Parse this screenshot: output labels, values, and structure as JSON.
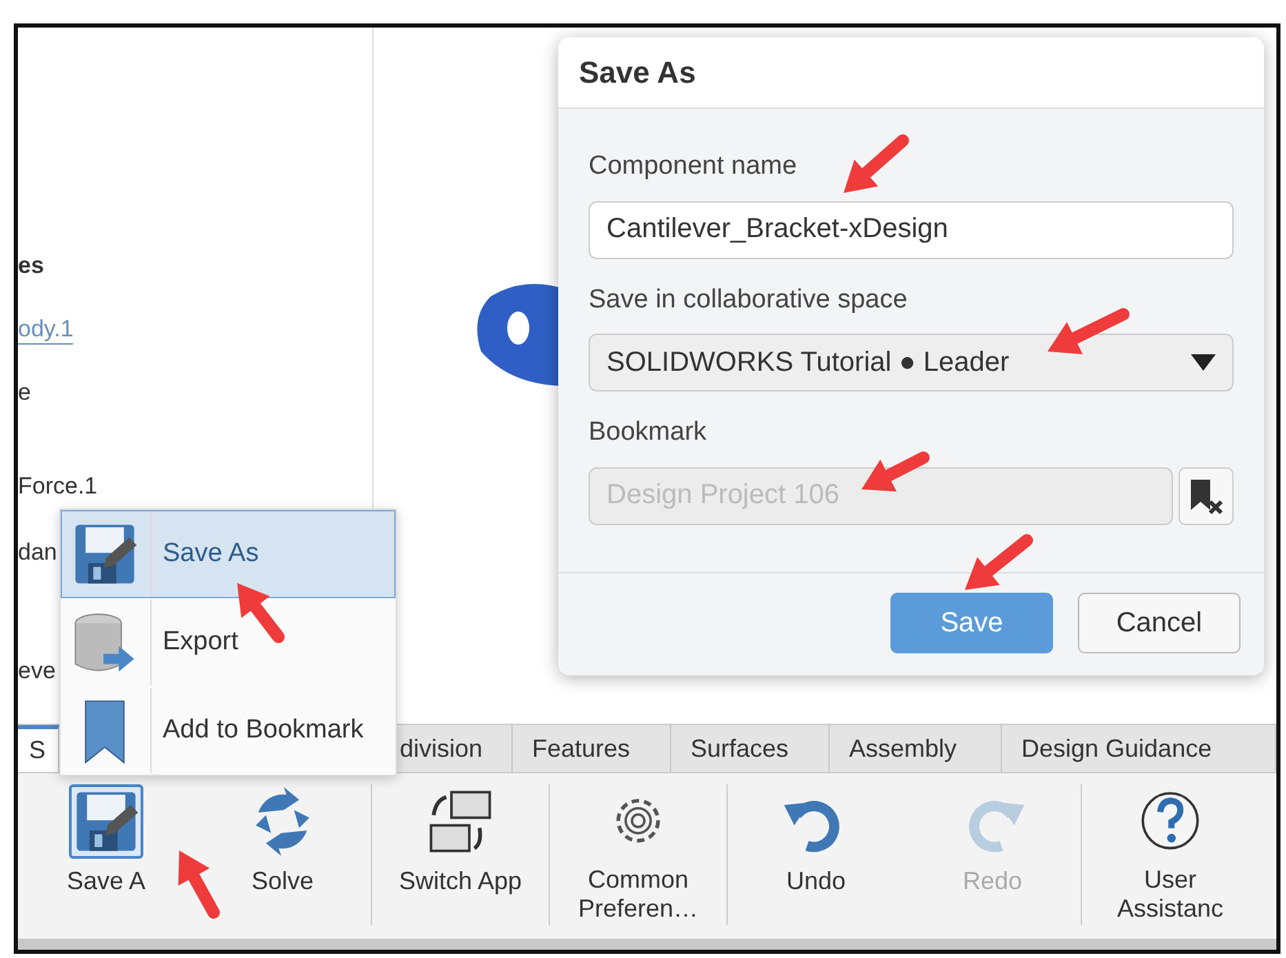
{
  "sidebar": {
    "items": [
      {
        "label": "es",
        "kind": "heading"
      },
      {
        "label": "ody.1",
        "kind": "link"
      },
      {
        "label": "e",
        "kind": "text"
      },
      {
        "label": "Force.1",
        "kind": "text"
      },
      {
        "label": "dan",
        "kind": "text"
      },
      {
        "label": "eve",
        "kind": "text"
      }
    ]
  },
  "tabs": [
    {
      "label": "S",
      "selected": true
    },
    {
      "label": "division",
      "selected": false
    },
    {
      "label": "Features",
      "selected": false
    },
    {
      "label": "Surfaces",
      "selected": false
    },
    {
      "label": "Assembly",
      "selected": false
    },
    {
      "label": "Design Guidance",
      "selected": false
    }
  ],
  "toolbar": {
    "groups": [
      [
        {
          "label": "Save A",
          "kind": "save",
          "selected": true,
          "disabled": false
        },
        {
          "label": "Solve",
          "kind": "solve",
          "selected": false,
          "disabled": false
        }
      ],
      [
        {
          "label": "Switch App",
          "kind": "switch",
          "selected": false,
          "disabled": false
        }
      ],
      [
        {
          "label": "Common Preferen…",
          "kind": "gear",
          "selected": false,
          "disabled": false
        }
      ],
      [
        {
          "label": "Undo",
          "kind": "undo",
          "selected": false,
          "disabled": false
        },
        {
          "label": "Redo",
          "kind": "redo",
          "selected": false,
          "disabled": true
        }
      ],
      [
        {
          "label": "User Assistanc",
          "kind": "help",
          "selected": false,
          "disabled": false
        }
      ]
    ]
  },
  "context_menu": {
    "items": [
      {
        "label": "Save As",
        "kind": "save",
        "selected": true
      },
      {
        "label": "Export",
        "kind": "export",
        "selected": false
      },
      {
        "label": "Add to Bookmark",
        "kind": "bookmark",
        "selected": false
      }
    ]
  },
  "dialog": {
    "title": "Save As",
    "name_label": "Component name",
    "name_value": "Cantilever_Bracket-xDesign",
    "space_label": "Save in collaborative space",
    "space_value": "SOLIDWORKS Tutorial ● Leader",
    "bookmark_label": "Bookmark",
    "bookmark_placeholder": "Design Project 106",
    "bookmark_disabled": true,
    "buttons": [
      {
        "label": "Save",
        "kind": "primary"
      },
      {
        "label": "Cancel",
        "kind": "secondary"
      }
    ]
  }
}
